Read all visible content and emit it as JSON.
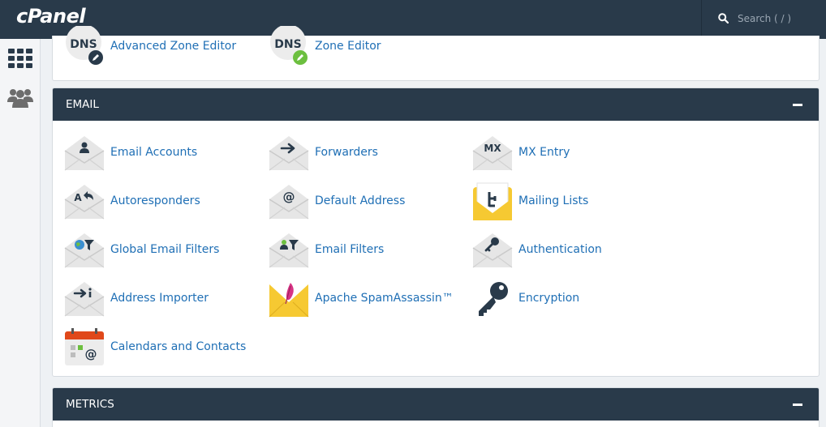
{
  "topbar": {
    "logo": "cPanel",
    "search": {
      "placeholder": "Search ( / )"
    }
  },
  "rail": {
    "items": [
      {
        "icon": "apps-grid-icon"
      },
      {
        "icon": "users-icon"
      }
    ]
  },
  "domains_card": {
    "items": [
      {
        "label": "Advanced Zone Editor",
        "icon_text": "DNS",
        "icon": "dns-pencil-icon"
      },
      {
        "label": "Zone Editor",
        "icon_text": "DNS",
        "icon": "dns-edit-icon"
      }
    ]
  },
  "email": {
    "title": "EMAIL",
    "items": [
      {
        "label": "Email Accounts",
        "icon": "envelope-user-icon"
      },
      {
        "label": "Forwarders",
        "icon": "envelope-arrow-icon"
      },
      {
        "label": "MX Entry",
        "icon": "envelope-mx-icon",
        "icon_text": "MX"
      },
      {
        "label": "Autoresponders",
        "icon": "envelope-reply-icon",
        "icon_text": "A"
      },
      {
        "label": "Default Address",
        "icon": "envelope-at-icon",
        "icon_text": "@"
      },
      {
        "label": "Mailing Lists",
        "icon": "mailing-list-icon"
      },
      {
        "label": "Global Email Filters",
        "icon": "envelope-globe-filter-icon"
      },
      {
        "label": "Email Filters",
        "icon": "envelope-user-filter-icon"
      },
      {
        "label": "Authentication",
        "icon": "envelope-key-icon"
      },
      {
        "label": "Address Importer",
        "icon": "envelope-import-icon"
      },
      {
        "label": "Apache SpamAssassin™",
        "icon": "spamassassin-feather-icon"
      },
      {
        "label": "Encryption",
        "icon": "key-icon"
      },
      {
        "label": "Calendars and Contacts",
        "icon": "calendar-icon",
        "icon_text": "@"
      }
    ]
  },
  "metrics": {
    "title": "METRICS"
  },
  "colors": {
    "topbar": "#293a4a",
    "link": "#1f6fb5",
    "envelope": "#e6e6e6",
    "envelope_dark": "#c9c9c9",
    "icon_dark": "#293a4a",
    "yellow": "#f6c932",
    "green": "#6cbf3f",
    "calendar_red": "#e0481a"
  }
}
